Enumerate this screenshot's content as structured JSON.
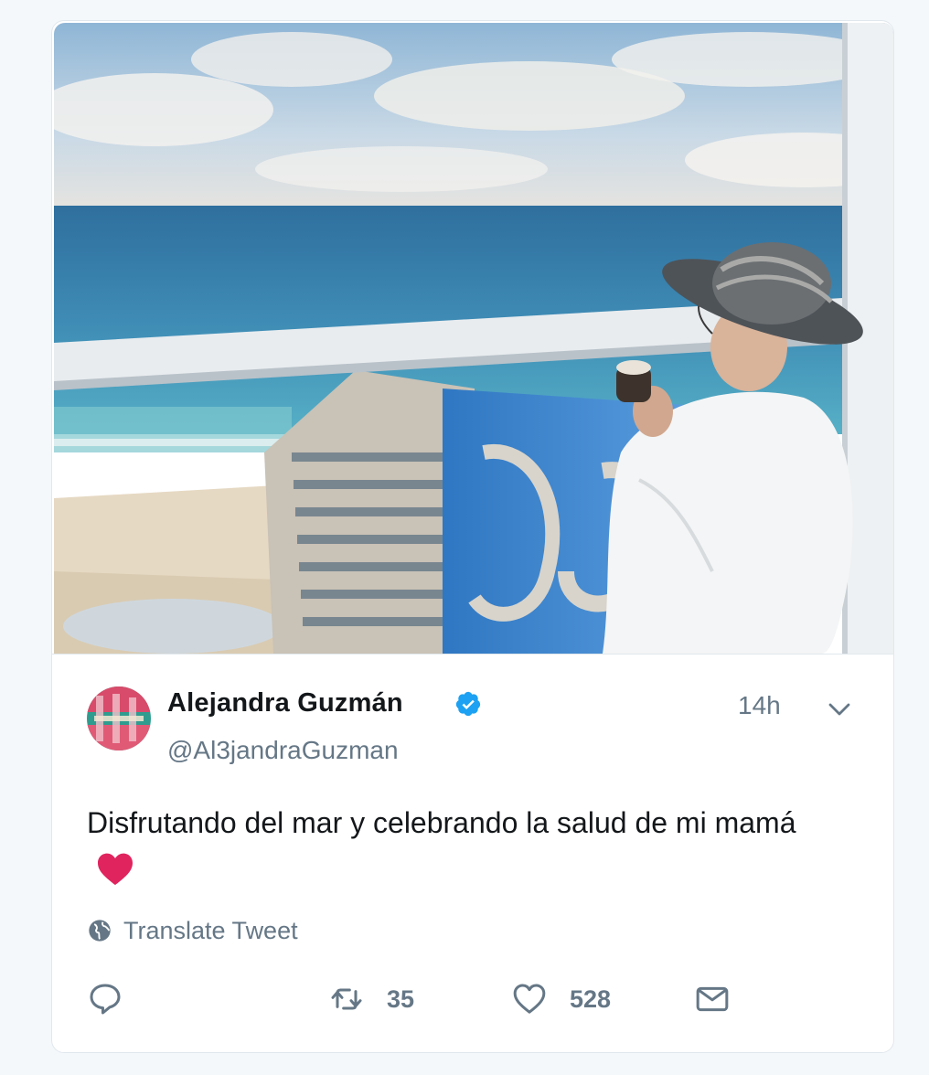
{
  "tweet": {
    "author": {
      "name": "Alejandra Guzmán",
      "handle": "@Al3jandraGuzman",
      "verified": true,
      "avatar_icon": "profile-avatar"
    },
    "timestamp": "14h",
    "text": "Disfrutando del mar y celebrando la salud de mi mamá",
    "emoji": "red-heart",
    "translate_label": "Translate Tweet",
    "actions": {
      "reply_count": "",
      "retweet_count": "35",
      "like_count": "528"
    }
  },
  "colors": {
    "verified_blue": "#1da1f2",
    "text_secondary": "#657786",
    "heart_red": "#e0245e"
  }
}
